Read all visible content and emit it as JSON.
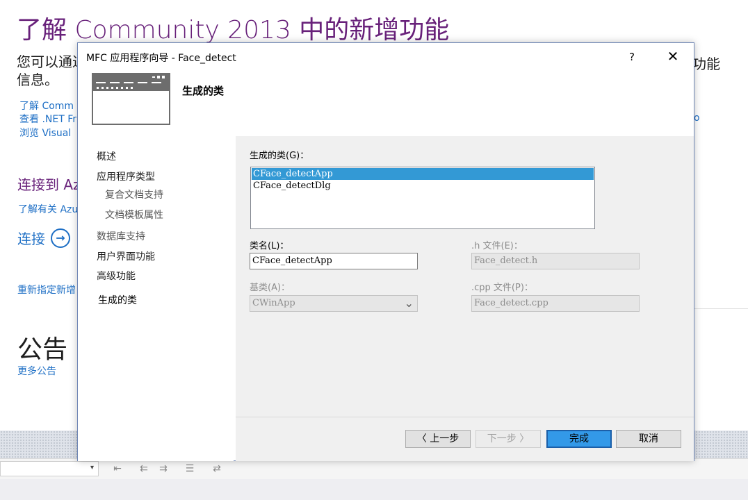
{
  "background": {
    "title": "了解 Community 2013 中的新增功能",
    "intro_line1": "您可以通过",
    "intro_line2": "信息。",
    "intro_right": "功能",
    "links": [
      "了解 Comm",
      "查看 .NET Fr",
      "浏览 Visual"
    ],
    "link_right": "o",
    "section_title": "连接到 Az",
    "azure_link": "了解有关 Azu",
    "connect_label": "连接",
    "connect_icon": "→",
    "retarget_link": "重新指定新增",
    "news_title": "公告",
    "more_news": "更多公告",
    "combo_arrow": "▾",
    "toolbar_icons": [
      "⇤",
      "⇇",
      "⇉",
      "☰",
      "⇄"
    ]
  },
  "dialog": {
    "title": "MFC 应用程序向导 - Face_detect",
    "help_label": "?",
    "close_label": "✕",
    "header_title": "生成的类",
    "nav": [
      {
        "label": "概述"
      },
      {
        "label": "应用程序类型"
      },
      {
        "label": "复合文档支持"
      },
      {
        "label": "文档模板属性"
      },
      {
        "label": "数据库支持"
      },
      {
        "label": "用户界面功能"
      },
      {
        "label": "高级功能"
      },
      {
        "label": "生成的类"
      }
    ],
    "form": {
      "generated_classes_label": "生成的类(G)：",
      "classes": [
        "CFace_detectApp",
        "CFace_detectDlg"
      ],
      "class_name_label": "类名(L)：",
      "class_name_value": "CFace_detectApp",
      "h_file_label": ".h 文件(E)：",
      "h_file_value": "Face_detect.h",
      "base_class_label": "基类(A)：",
      "base_class_value": "CWinApp",
      "cpp_file_label": ".cpp 文件(P)：",
      "cpp_file_value": "Face_detect.cpp",
      "dropdown_arrow": "⌄"
    },
    "buttons": {
      "prev": "〈 上一步",
      "next": "下一步 〉",
      "finish": "完成",
      "cancel": "取消"
    }
  }
}
